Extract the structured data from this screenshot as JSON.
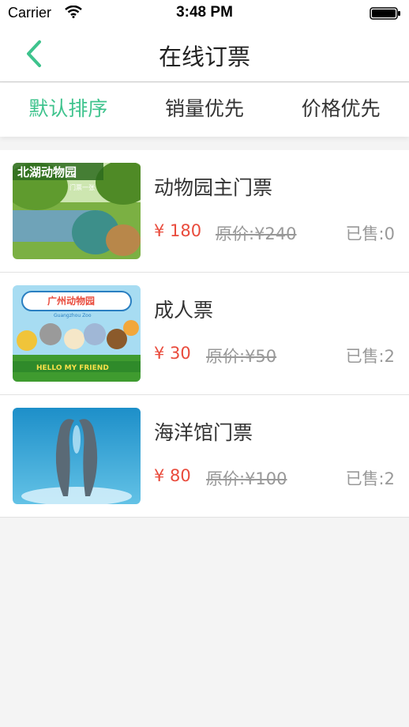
{
  "status": {
    "carrier": "Carrier",
    "time": "3:48 PM"
  },
  "nav": {
    "title": "在线订票",
    "back_icon": "chevron-left-icon"
  },
  "tabs": [
    {
      "label": "默认排序",
      "active": true
    },
    {
      "label": "销量优先",
      "active": false
    },
    {
      "label": "价格优先",
      "active": false
    }
  ],
  "tickets": [
    {
      "name": "动物园主门票",
      "price": "¥ 180",
      "original": "原价:¥240",
      "sold": "已售:0",
      "thumb_text": "北湖动物园",
      "thumb_sub": "门票一张"
    },
    {
      "name": "成人票",
      "price": "¥ 30",
      "original": "原价:¥50",
      "sold": "已售:2",
      "thumb_text": "广州动物园",
      "thumb_sub": "Guangzhou Zoo",
      "thumb_banner": "HELLO MY FRIEND"
    },
    {
      "name": "海洋馆门票",
      "price": "¥ 80",
      "original": "原价:¥100",
      "sold": "已售:2"
    }
  ],
  "colors": {
    "accent": "#3ec38d",
    "price": "#e94b3c",
    "muted": "#999999"
  }
}
